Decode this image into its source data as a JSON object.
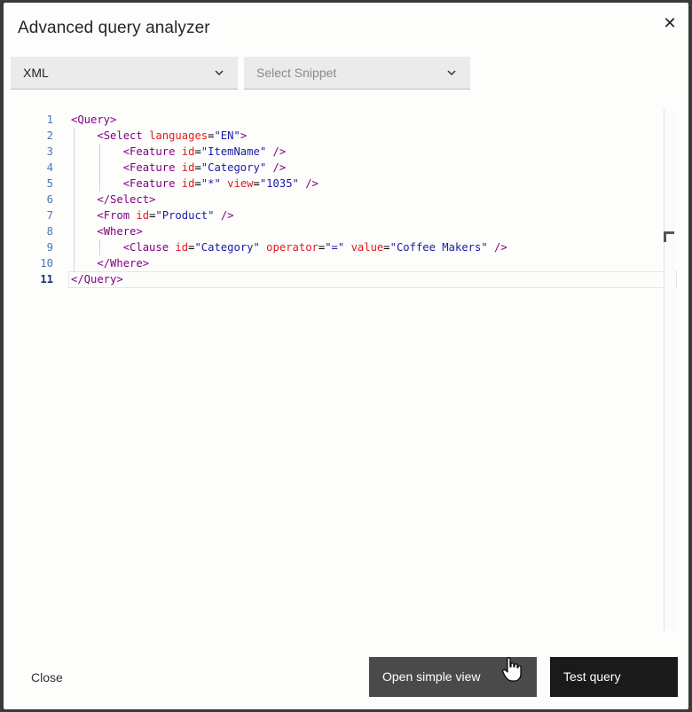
{
  "dialog": {
    "title": "Advanced query analyzer",
    "close_icon": "close-icon"
  },
  "toolbar": {
    "language": {
      "selected": "XML",
      "icon": "chevron-down-icon"
    },
    "snippet": {
      "placeholder": "Select Snippet",
      "icon": "chevron-down-icon"
    }
  },
  "editor": {
    "line_numbers": [
      "1",
      "2",
      "3",
      "4",
      "5",
      "6",
      "7",
      "8",
      "9",
      "10",
      "11"
    ],
    "active_line": 11,
    "colors": {
      "tag": "#800080",
      "attribute": "#e21a1a",
      "value": "#1a1aa6",
      "line_number": "#4a77b4"
    }
  },
  "footer": {
    "close_label": "Close",
    "open_simple_view_label": "Open simple view",
    "test_query_label": "Test query"
  }
}
